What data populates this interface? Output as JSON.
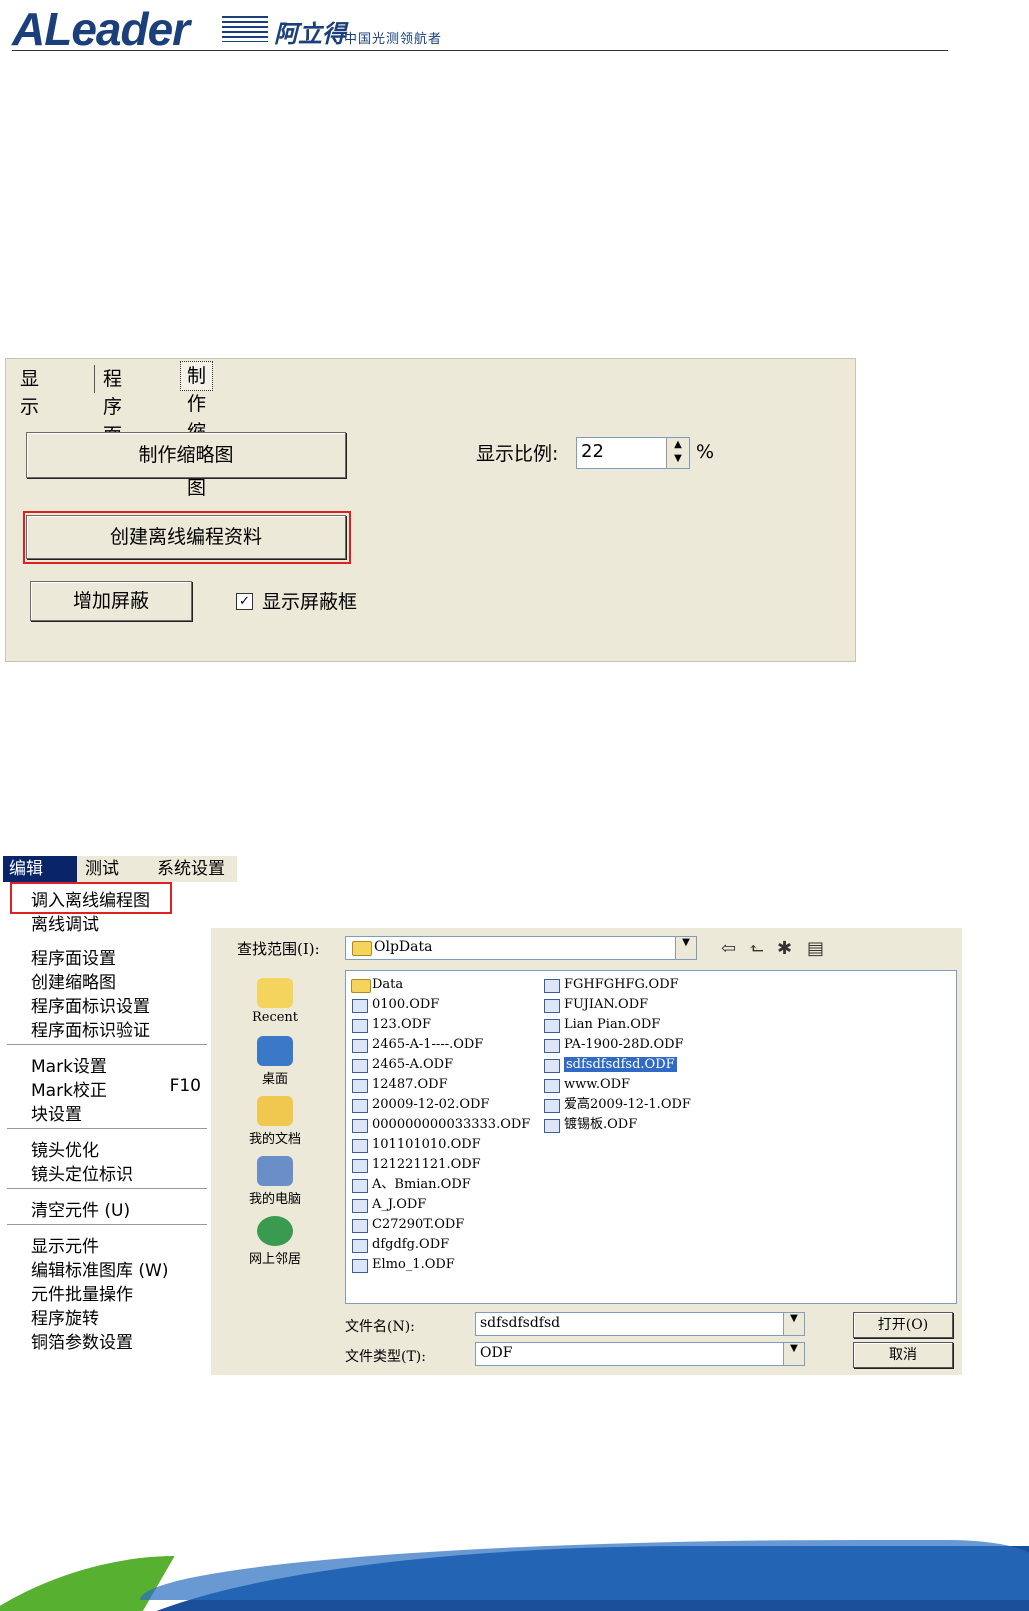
{
  "header": {
    "brand": "ALeader",
    "brand_cn": "阿立得",
    "slogan": "中国光测领航者"
  },
  "panel1": {
    "tabs": [
      "显示",
      "程序面",
      "制作缩略图"
    ],
    "make_thumbnail_label": "制作缩略图",
    "create_offline_label": "创建离线编程资料",
    "add_mask_label": "增加屏蔽",
    "show_mask_label": "显示屏蔽框",
    "show_mask_checked": true,
    "checkmark": "✓",
    "scale_label": "显示比例:",
    "scale_value": "22",
    "percent": "%"
  },
  "menu": {
    "bar": [
      "编辑",
      "测试",
      "系统设置"
    ],
    "items": [
      "调入离线编程图",
      "离线调试",
      "程序面设置",
      "创建缩略图",
      "程序面标识设置",
      "程序面标识验证",
      "Mark设置",
      "Mark校正",
      "块设置",
      "镜头优化",
      "镜头定位标识",
      "清空元件 (U)",
      "显示元件",
      "编辑标准图库 (W)",
      "元件批量操作",
      "程序旋转",
      "铜箔参数设置"
    ],
    "mark_shortcut": "F10"
  },
  "dialog": {
    "look_in_label": "查找范围(I):",
    "look_in_value": "OlpData",
    "places": [
      "Recent",
      "桌面",
      "我的文档",
      "我的电脑",
      "网上邻居"
    ],
    "files_col1": [
      "Data",
      "0100.ODF",
      "123.ODF",
      "2465-A-1----.ODF",
      "2465-A.ODF",
      "12487.ODF",
      "20009-12-02.ODF",
      "000000000033333.ODF",
      "101101010.ODF",
      "121221121.ODF",
      "A、Bmian.ODF",
      "A_J.ODF",
      "C27290T.ODF",
      "dfgdfg.ODF",
      "Elmo_1.ODF"
    ],
    "files_col2": [
      "FGHFGHFG.ODF",
      "FUJIAN.ODF",
      "Lian Pian.ODF",
      "PA-1900-28D.ODF",
      "sdfsdfsdfsd.ODF",
      "www.ODF",
      "爱高2009-12-1.ODF",
      "镀锡板.ODF"
    ],
    "selected_file": "sdfsdfsdfsd.ODF",
    "filename_label": "文件名(N):",
    "filename_value": "sdfsdfsdfsd",
    "filetype_label": "文件类型(T):",
    "filetype_value": "ODF",
    "open_label": "打开(O)",
    "cancel_label": "取消"
  },
  "icons": {
    "dropdown": "▼",
    "back": "⇦",
    "up_folder": "⬑",
    "new_folder": "✱",
    "view_menu": "▤",
    "spin_up": "▲",
    "spin_down": "▼"
  },
  "colors": {
    "brand_blue": "#1a3f7a",
    "highlight": "#e02020",
    "selection": "#316ac5"
  }
}
